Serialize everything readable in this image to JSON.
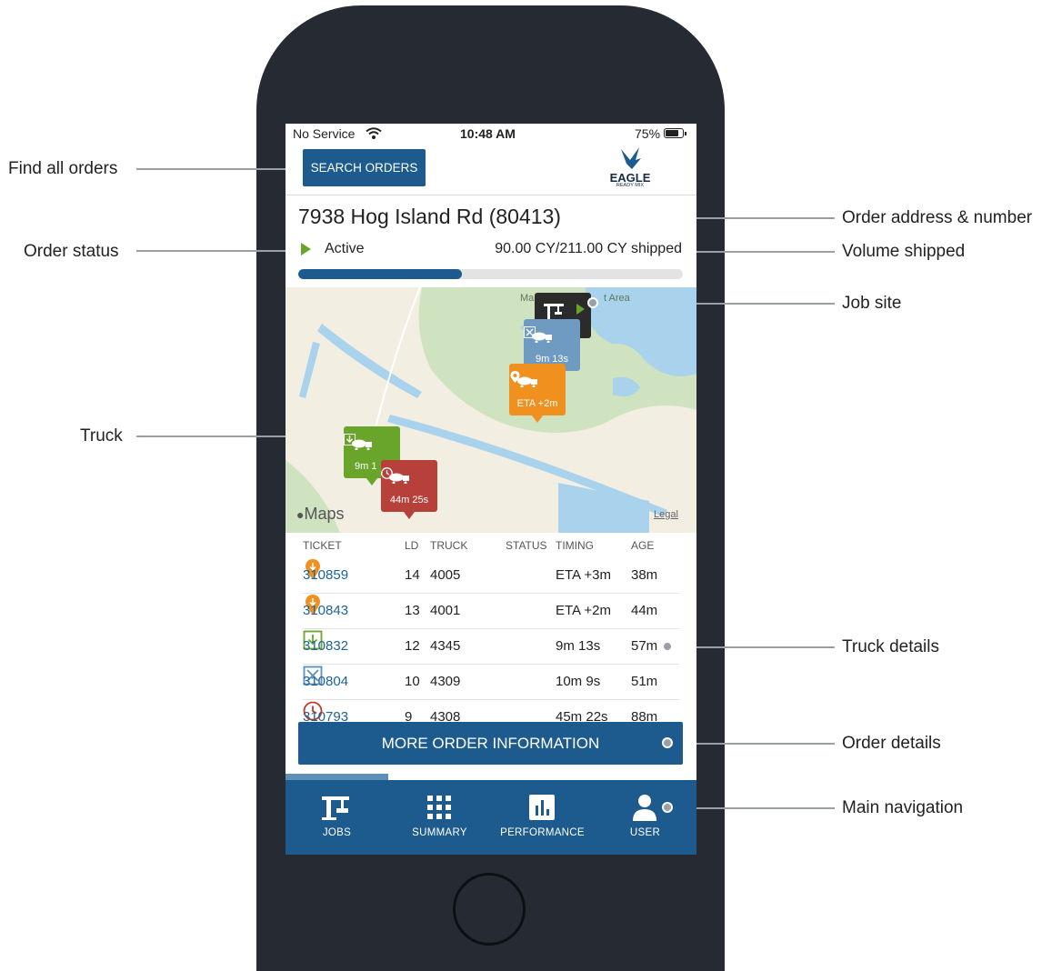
{
  "callouts": {
    "find_all_orders": "Find all orders",
    "order_status": "Order status",
    "truck": "Truck",
    "order_address": "Order address & number",
    "volume_shipped": "Volume shipped",
    "job_site": "Job site",
    "truck_details": "Truck details",
    "order_details": "Order details",
    "main_navigation": "Main navigation"
  },
  "status_bar": {
    "carrier": "No Service",
    "time": "10:48 AM",
    "battery": "75%",
    "battery_level": 0.75
  },
  "header": {
    "search_button": "SEARCH ORDERS",
    "logo_brand": "EAGLE",
    "logo_sub": "READY MIX"
  },
  "order": {
    "address": "7938 Hog Island Rd (80413)",
    "status": "Active",
    "volume": "90.00 CY/211.00 CY shipped",
    "progress_fraction": 0.4265
  },
  "map": {
    "maps_logo": "Maps",
    "legal": "Legal",
    "labels": [
      "Ma",
      "t Area"
    ],
    "pins": [
      {
        "kind": "job-site",
        "color": "#2b2b2b",
        "label": ""
      },
      {
        "kind": "truck",
        "status": "washout",
        "color": "#6f9bc2",
        "label": "9m 13s"
      },
      {
        "kind": "truck",
        "status": "en-route",
        "color": "#f0901e",
        "label": "ETA +2m"
      },
      {
        "kind": "truck",
        "status": "unloading",
        "color": "#6aa52b",
        "label": "9m 1"
      },
      {
        "kind": "truck",
        "status": "waiting",
        "color": "#b8403a",
        "label": "44m 25s"
      }
    ]
  },
  "table": {
    "headers": {
      "ticket": "TICKET",
      "ld": "LD",
      "truck": "TRUCK",
      "status": "STATUS",
      "timing": "TIMING",
      "age": "AGE"
    },
    "rows": [
      {
        "ticket": "310859",
        "ld": "14",
        "truck": "4005",
        "status_icon": "location-pin-icon",
        "status_color": "#f0901e",
        "timing": "ETA +3m",
        "age": "38m"
      },
      {
        "ticket": "310843",
        "ld": "13",
        "truck": "4001",
        "status_icon": "location-pin-icon",
        "status_color": "#f0901e",
        "timing": "ETA +2m",
        "age": "44m"
      },
      {
        "ticket": "310832",
        "ld": "12",
        "truck": "4345",
        "status_icon": "unload-icon",
        "status_color": "#6aa52b",
        "timing": "9m 13s",
        "age": "57m"
      },
      {
        "ticket": "310804",
        "ld": "10",
        "truck": "4309",
        "status_icon": "washout-icon",
        "status_color": "#5b8fbd",
        "timing": "10m 9s",
        "age": "51m"
      },
      {
        "ticket": "310793",
        "ld": "9",
        "truck": "4308",
        "status_icon": "clock-icon",
        "status_color": "#c0392b",
        "timing": "45m 22s",
        "age": "88m"
      }
    ]
  },
  "more_button": "MORE ORDER INFORMATION",
  "nav": {
    "items": [
      {
        "label": "JOBS",
        "icon": "crane-icon"
      },
      {
        "label": "SUMMARY",
        "icon": "grid-icon"
      },
      {
        "label": "PERFORMANCE",
        "icon": "bar-chart-icon"
      },
      {
        "label": "USER",
        "icon": "user-icon"
      }
    ]
  },
  "colors": {
    "brand_blue": "#1d5b8e",
    "link_blue": "#1d6496",
    "active_green": "#6aa52b"
  }
}
